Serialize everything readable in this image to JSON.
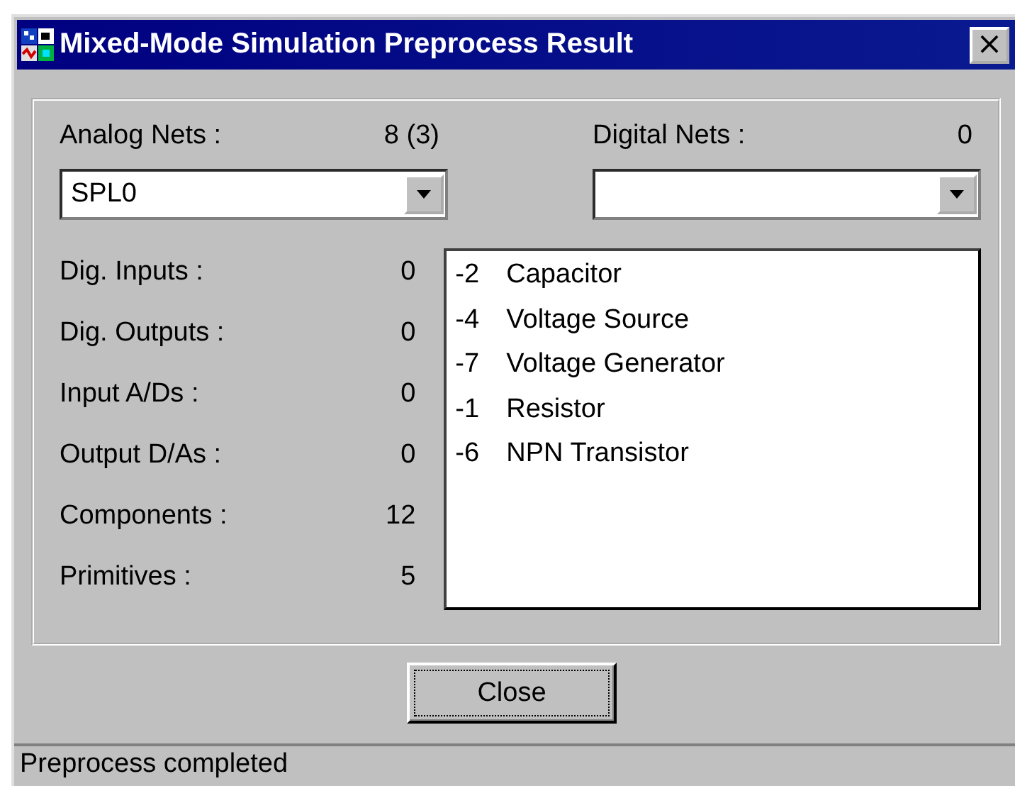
{
  "window": {
    "title": "Mixed-Mode Simulation Preprocess Result",
    "close": "×"
  },
  "analog_nets": {
    "label": "Analog Nets :",
    "value": "8 (3)",
    "dropdown": "SPL0"
  },
  "digital_nets": {
    "label": "Digital Nets :",
    "value": "0"
  },
  "stats": [
    {
      "label": "Dig. Inputs :",
      "value": "0"
    },
    {
      "label": "Dig. Outputs :",
      "value": "0"
    },
    {
      "label": "Input A/Ds :",
      "value": "0"
    },
    {
      "label": "Output D/As :",
      "value": "0"
    },
    {
      "label": "Components :",
      "value": "12"
    },
    {
      "label": "Primitives :",
      "value": "5"
    }
  ],
  "components": [
    {
      "count": "-2",
      "name": "Capacitor"
    },
    {
      "count": "-4",
      "name": "Voltage Source"
    },
    {
      "count": "-7",
      "name": "Voltage Generator"
    },
    {
      "count": "-1",
      "name": "Resistor"
    },
    {
      "count": "-6",
      "name": "NPN Transistor"
    }
  ],
  "buttons": [
    "Close"
  ],
  "status_bar": "Preprocess completed"
}
